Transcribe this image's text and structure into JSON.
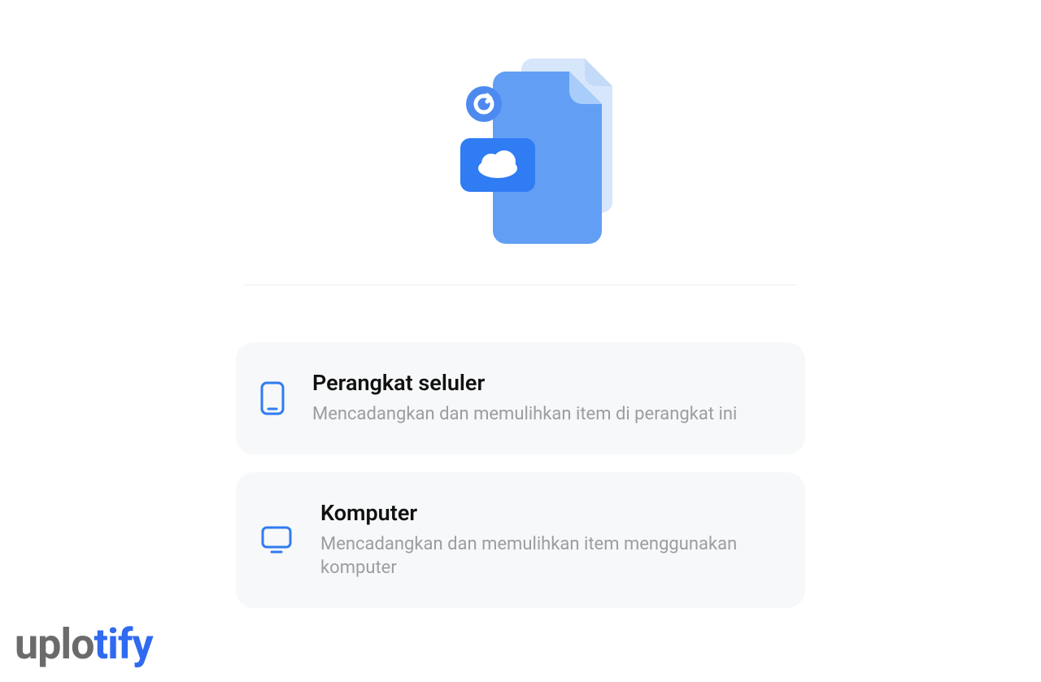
{
  "options": [
    {
      "title": "Perangkat seluler",
      "description": "Mencadangkan dan memulihkan item di perangkat ini"
    },
    {
      "title": "Komputer",
      "description": "Mencadangkan dan memulihkan item menggunakan komputer"
    }
  ],
  "watermark": {
    "part1": "uplo",
    "part2": "tify"
  }
}
